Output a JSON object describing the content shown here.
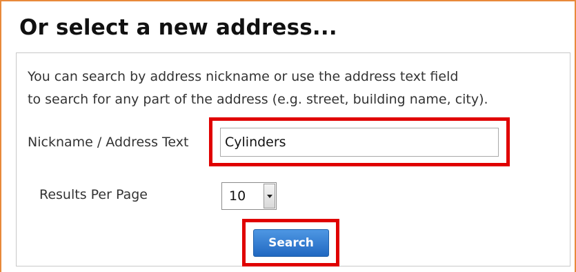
{
  "section": {
    "title": "Or select a new address...",
    "description_line1": "You can search by address nickname or use the address text field",
    "description_line2": "to search for any part of the address (e.g. street, building name, city)."
  },
  "form": {
    "nickname_label": "Nickname / Address Text",
    "nickname_value": "Cylinders",
    "results_label": "Results Per Page",
    "results_value": "10",
    "search_label": "Search"
  },
  "colors": {
    "frame_border": "#e8893a",
    "highlight": "#e00000",
    "button": "#2f7fd6"
  }
}
